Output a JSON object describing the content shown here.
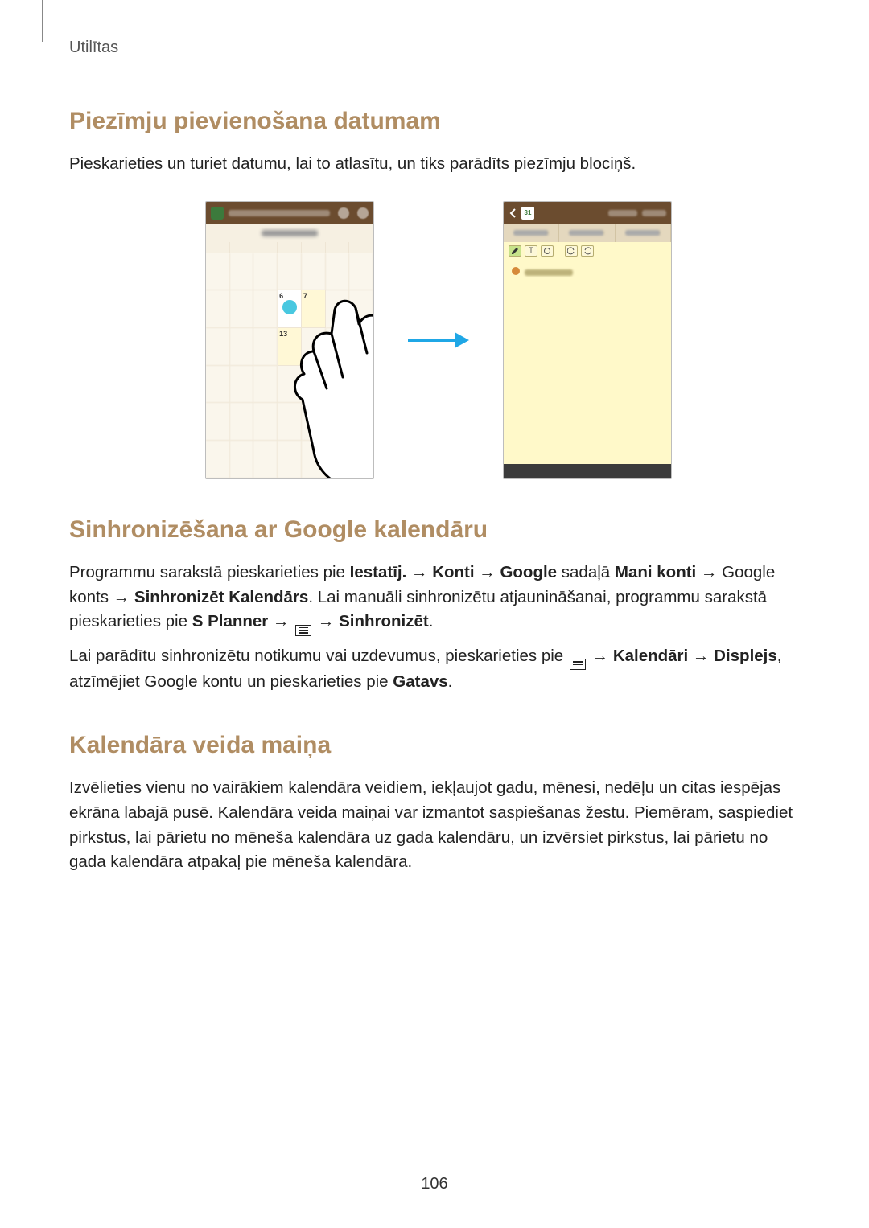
{
  "header": {
    "breadcrumb": "Utilītas"
  },
  "section1": {
    "title": "Piezīmju pievienošana datumam",
    "p1": "Pieskarieties un turiet datumu, lai to atlasītu, un tiks parādīts piezīmju blociņš."
  },
  "figure": {
    "cal": {
      "cell6": "6",
      "cell7": "7",
      "cell13": "13"
    },
    "toolbar": {
      "text_label": "T"
    }
  },
  "section2": {
    "title": "Sinhronizēšana ar Google kalendāru",
    "p1_a": "Programmu sarakstā pieskarieties pie ",
    "p1_b": "Iestatīj.",
    "p1_c": " → ",
    "p1_d": "Konti",
    "p1_e": " → ",
    "p1_f": "Google",
    "p1_g": " sadaļā ",
    "p1_h": "Mani konti",
    "p1_i": " → Google konts → ",
    "p1_j": "Sinhronizēt Kalendārs",
    "p1_k": ". Lai manuāli sinhronizētu atjaunināšanai, programmu sarakstā pieskarieties pie ",
    "p1_l": "S Planner",
    "p1_m": " → ",
    "p1_n": " → ",
    "p1_o": "Sinhronizēt",
    "p1_p": ".",
    "p2_a": "Lai parādītu sinhronizētu notikumu vai uzdevumus, pieskarieties pie ",
    "p2_b": " → ",
    "p2_c": "Kalendāri",
    "p2_d": " → ",
    "p2_e": "Displejs",
    "p2_f": ", atzīmējiet Google kontu un pieskarieties pie ",
    "p2_g": "Gatavs",
    "p2_h": "."
  },
  "section3": {
    "title": "Kalendāra veida maiņa",
    "p1": "Izvēlieties vienu no vairākiem kalendāra veidiem, iekļaujot gadu, mēnesi, nedēļu un citas iespējas ekrāna labajā pusē. Kalendāra veida maiņai var izmantot saspiešanas žestu. Piemēram, saspiediet pirkstus, lai pārietu no mēneša kalendāra uz gada kalendāru, un izvērsiet pirkstus, lai pārietu no gada kalendāra atpakaļ pie mēneša kalendāra."
  },
  "page_number": "106"
}
